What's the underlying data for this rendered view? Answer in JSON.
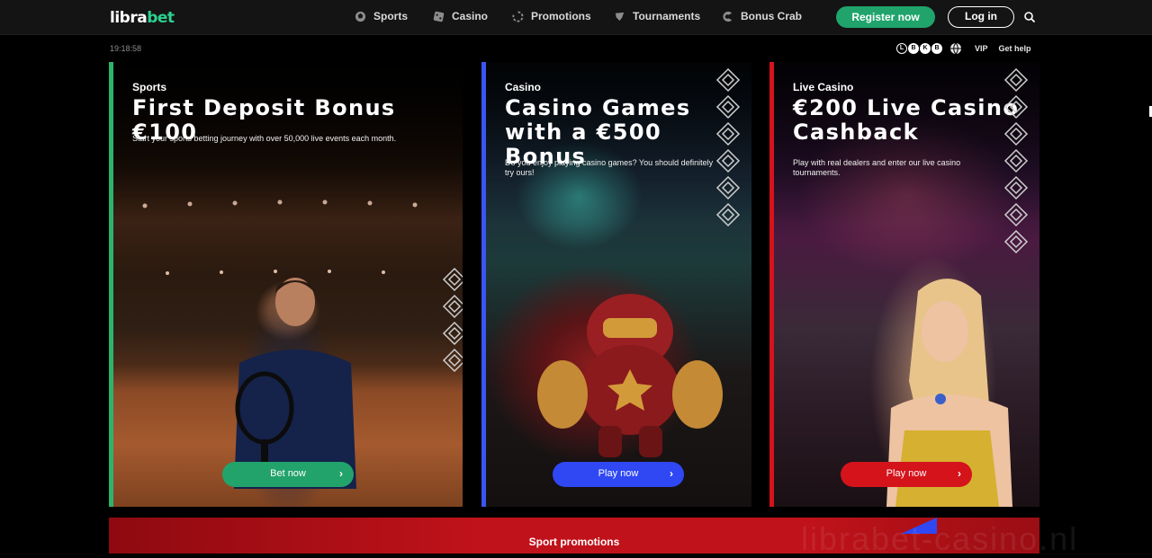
{
  "brand": {
    "name_part1": "libra",
    "name_part2": "bet",
    "accent_color": "#2bd18f"
  },
  "nav": {
    "items": [
      {
        "label": "Sports",
        "icon": "soccer-ball-icon"
      },
      {
        "label": "Casino",
        "icon": "dice-icon"
      },
      {
        "label": "Promotions",
        "icon": "refresh-icon"
      },
      {
        "label": "Tournaments",
        "icon": "trophy-icon"
      },
      {
        "label": "Bonus Crab",
        "icon": "crab-claw-icon"
      }
    ],
    "register_label": "Register now",
    "login_label": "Log in"
  },
  "subbar": {
    "clock": "19:18:58",
    "vip_label": "VIP",
    "help_label": "Get help",
    "rg_badges": [
      "L",
      "B",
      "K",
      "B"
    ]
  },
  "cards": {
    "sports": {
      "eyebrow": "Sports",
      "title": "First Deposit Bonus €100",
      "desc": "Start your sports betting journey with over 50,000 live events each month.",
      "button": "Bet now",
      "accent": "#2eb36f"
    },
    "casino": {
      "eyebrow": "Casino",
      "title": "Casino Games with a €500 Bonus",
      "desc": "Do you enjoy playing casino games? You should definitely try ours!",
      "button": "Play now",
      "accent": "#3b56f0"
    },
    "live": {
      "eyebrow": "Live Casino",
      "title": "€200 Live Casino Cashback",
      "desc": "Play with real dealers and enter our live casino tournaments.",
      "button": "Play now",
      "accent": "#d4131b"
    }
  },
  "band": {
    "title": "Sport promotions"
  },
  "watermark": "librabet-casino.nl"
}
